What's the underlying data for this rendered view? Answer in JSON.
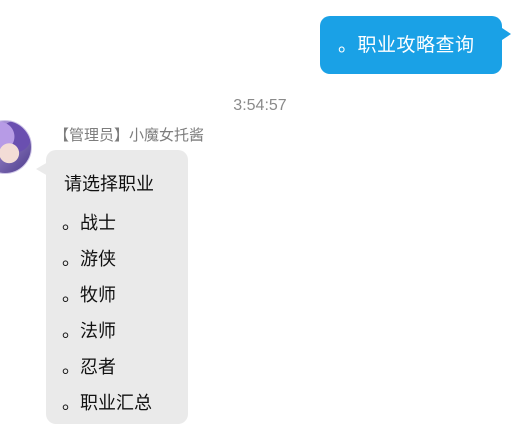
{
  "outgoing_message": {
    "text": "。职业攻略查询"
  },
  "timestamp": "3:54:57",
  "incoming": {
    "sender": "【管理员】小魔女托酱",
    "prompt": "请选择职业",
    "options": [
      "。战士",
      "。游侠",
      "。牧师",
      "。法师",
      "。忍者",
      "。职业汇总"
    ]
  },
  "colors": {
    "outgoing_bubble": "#1aa1e6",
    "incoming_bubble": "#eaeaea",
    "meta_text": "#8a8a8a"
  }
}
